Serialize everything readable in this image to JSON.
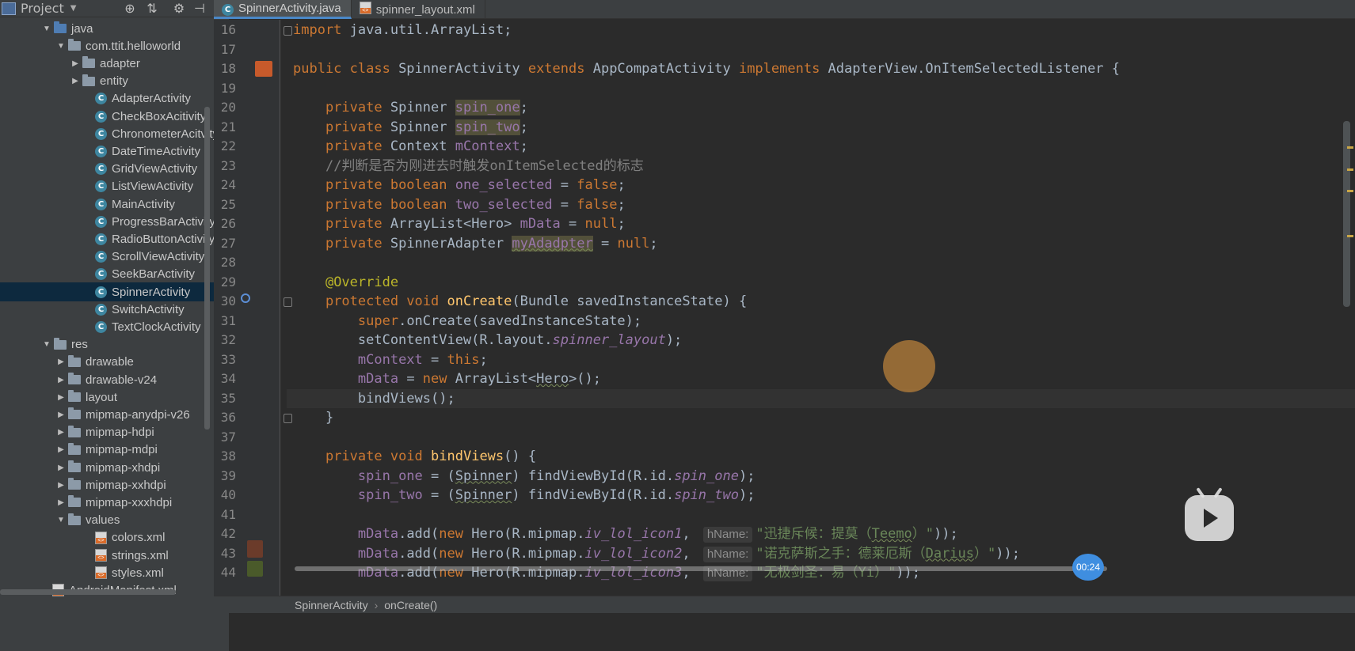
{
  "project": {
    "title": "Project",
    "tree": [
      {
        "label": "java",
        "kind": "folder-blue",
        "indent": 3,
        "arrow": "down"
      },
      {
        "label": "com.ttit.helloworld",
        "kind": "folder",
        "indent": 4,
        "arrow": "down"
      },
      {
        "label": "adapter",
        "kind": "folder",
        "indent": 5,
        "arrow": "right"
      },
      {
        "label": "entity",
        "kind": "folder",
        "indent": 5,
        "arrow": "right"
      },
      {
        "label": "AdapterActivity",
        "kind": "class",
        "indent": 6
      },
      {
        "label": "CheckBoxAcitivity",
        "kind": "class",
        "indent": 6
      },
      {
        "label": "ChronometerAcitvity",
        "kind": "class",
        "indent": 6
      },
      {
        "label": "DateTimeActivity",
        "kind": "class",
        "indent": 6
      },
      {
        "label": "GridViewActivity",
        "kind": "class",
        "indent": 6
      },
      {
        "label": "ListViewActivity",
        "kind": "class",
        "indent": 6
      },
      {
        "label": "MainActivity",
        "kind": "class",
        "indent": 6
      },
      {
        "label": "ProgressBarActivity",
        "kind": "class",
        "indent": 6
      },
      {
        "label": "RadioButtonActivity",
        "kind": "class",
        "indent": 6
      },
      {
        "label": "ScrollViewActivity",
        "kind": "class",
        "indent": 6
      },
      {
        "label": "SeekBarActivity",
        "kind": "class",
        "indent": 6
      },
      {
        "label": "SpinnerActivity",
        "kind": "class",
        "indent": 6,
        "selected": true
      },
      {
        "label": "SwitchActivity",
        "kind": "class",
        "indent": 6
      },
      {
        "label": "TextClockActivity",
        "kind": "class",
        "indent": 6
      },
      {
        "label": "res",
        "kind": "folder",
        "indent": 3,
        "arrow": "down"
      },
      {
        "label": "drawable",
        "kind": "folder",
        "indent": 4,
        "arrow": "right"
      },
      {
        "label": "drawable-v24",
        "kind": "folder",
        "indent": 4,
        "arrow": "right"
      },
      {
        "label": "layout",
        "kind": "folder",
        "indent": 4,
        "arrow": "right"
      },
      {
        "label": "mipmap-anydpi-v26",
        "kind": "folder",
        "indent": 4,
        "arrow": "right"
      },
      {
        "label": "mipmap-hdpi",
        "kind": "folder",
        "indent": 4,
        "arrow": "right"
      },
      {
        "label": "mipmap-mdpi",
        "kind": "folder",
        "indent": 4,
        "arrow": "right"
      },
      {
        "label": "mipmap-xhdpi",
        "kind": "folder",
        "indent": 4,
        "arrow": "right"
      },
      {
        "label": "mipmap-xxhdpi",
        "kind": "folder",
        "indent": 4,
        "arrow": "right"
      },
      {
        "label": "mipmap-xxxhdpi",
        "kind": "folder",
        "indent": 4,
        "arrow": "right"
      },
      {
        "label": "values",
        "kind": "folder",
        "indent": 4,
        "arrow": "down"
      },
      {
        "label": "colors.xml",
        "kind": "xml",
        "indent": 6
      },
      {
        "label": "strings.xml",
        "kind": "xml",
        "indent": 6
      },
      {
        "label": "styles.xml",
        "kind": "xml",
        "indent": 6
      },
      {
        "label": "AndroidManifest.xml",
        "kind": "xml",
        "indent": 3
      }
    ]
  },
  "tabs": [
    {
      "label": "SpinnerActivity.java",
      "active": true
    },
    {
      "label": "spinner_layout.xml",
      "active": false
    }
  ],
  "editor": {
    "lines": [
      {
        "n": "16",
        "html": "<span class='kw'>import</span> java.util.ArrayList;"
      },
      {
        "n": "17",
        "html": ""
      },
      {
        "n": "18",
        "html": "<span class='kw'>public class</span> SpinnerActivity <span class='kw'>extends</span> AppCompatActivity <span class='kw'>implements</span> AdapterView.OnItemSelectedListener {"
      },
      {
        "n": "19",
        "html": ""
      },
      {
        "n": "20",
        "html": "    <span class='kw'>private</span> Spinner <span class='fld hl'>spin_one</span>;"
      },
      {
        "n": "21",
        "html": "    <span class='kw'>private</span> Spinner <span class='fld hl'>spin_two</span>;"
      },
      {
        "n": "22",
        "html": "    <span class='kw'>private</span> Context <span class='fld'>mContext</span>;"
      },
      {
        "n": "23",
        "html": "    <span class='cmt'>//判断是否为刚进去时触发onItemSelected的标志</span>"
      },
      {
        "n": "24",
        "html": "    <span class='kw'>private boolean</span> <span class='fld'>one_selected</span> = <span class='kw'>false</span>;"
      },
      {
        "n": "25",
        "html": "    <span class='kw'>private boolean</span> <span class='fld'>two_selected</span> = <span class='kw'>false</span>;"
      },
      {
        "n": "26",
        "html": "    <span class='kw'>private</span> ArrayList&lt;Hero&gt; <span class='fld'>mData</span> = <span class='kw'>null</span>;"
      },
      {
        "n": "27",
        "html": "    <span class='kw'>private</span> SpinnerAdapter <span class='fld hl squig'>myAdadpter</span> = <span class='kw'>null</span>;"
      },
      {
        "n": "28",
        "html": ""
      },
      {
        "n": "29",
        "html": "    <span class='ann'>@Override</span>"
      },
      {
        "n": "30",
        "html": "    <span class='kw'>protected void</span> <span class='mth'>onCreate</span>(Bundle savedInstanceState) {"
      },
      {
        "n": "31",
        "html": "        <span class='kw'>super</span>.onCreate(savedInstanceState);"
      },
      {
        "n": "32",
        "html": "        setContentView(R.layout.<span class='ital'>spinner_layout</span>);"
      },
      {
        "n": "33",
        "html": "        <span class='fld'>mContext</span> = <span class='kw'>this</span>;"
      },
      {
        "n": "34",
        "html": "        <span class='fld'>mData</span> = <span class='kw'>new</span> ArrayList&lt;<span class='squig'>Hero</span>&gt;();"
      },
      {
        "n": "35",
        "html": "        bindViews();",
        "current": true
      },
      {
        "n": "36",
        "html": "    }"
      },
      {
        "n": "37",
        "html": ""
      },
      {
        "n": "38",
        "html": "    <span class='kw'>private void</span> <span class='mth'>bindViews</span>() {"
      },
      {
        "n": "39",
        "html": "        <span class='fld'>spin_one</span> = (<span class='squig'>Spinner</span>) findViewById(R.id.<span class='ital'>spin_one</span>);"
      },
      {
        "n": "40",
        "html": "        <span class='fld'>spin_two</span> = (<span class='squig'>Spinner</span>) findViewById(R.id.<span class='ital'>spin_two</span>);"
      },
      {
        "n": "41",
        "html": ""
      },
      {
        "n": "42",
        "html": "        <span class='fld'>mData</span>.add(<span class='kw'>new</span> Hero(R.mipmap.<span class='ital'>iv_lol_icon1</span>, <span class='hint'>hName:</span><span class='str'>\"迅捷斥候：提莫（<span class='squig'>Teemo</span>）\"</span>));"
      },
      {
        "n": "43",
        "html": "        <span class='fld'>mData</span>.add(<span class='kw'>new</span> Hero(R.mipmap.<span class='ital'>iv_lol_icon2</span>, <span class='hint'>hName:</span><span class='str'>\"诺克萨斯之手：德莱厄斯（<span class='squig'>Darius</span>）\"</span>));"
      },
      {
        "n": "44",
        "html": "        <span class='fld'>mData</span>.add(<span class='kw'>new</span> Hero(R.mipmap.<span class='ital'>iv_lol_icon3</span>, <span class='hint'>hName:</span><span class='str'>\"无极剑圣：易（Yi）\"</span>));"
      }
    ]
  },
  "breadcrumb": {
    "class_name": "SpinnerActivity",
    "method": "onCreate()"
  },
  "video": {
    "time": "00:24"
  }
}
